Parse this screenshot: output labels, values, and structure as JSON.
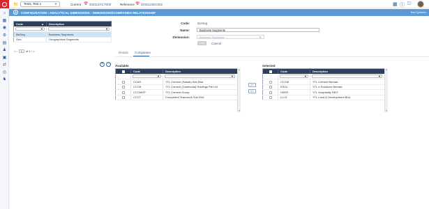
{
  "topbar": {
    "selector": "Test1, Test 1",
    "current_label": "Current",
    "current_value": "202112ACT000",
    "reference_label": "Reference",
    "reference_value": "201512JEC002"
  },
  "breadcrumb": {
    "text": "CONFIGURATION › ANALYTICAL DIMENSIONS › DIMENSIONS/COMPANIES RELATIONSHIP",
    "right_text": "Test Cyadmin"
  },
  "left_grid": {
    "headers": [
      "Code",
      "Description"
    ],
    "rows": [
      {
        "code": "BizSeg",
        "description": "Business Segments"
      },
      {
        "code": "Geo",
        "description": "Geographical Segments"
      }
    ]
  },
  "pager": {
    "page": "1",
    "of_text": "of 1"
  },
  "form": {
    "code_label": "Code:",
    "code_value": "BizSeg",
    "name_label": "Name:",
    "name_value": "Business Segments",
    "dimension_label": "Dimension:",
    "dimension_value": "Business Segments",
    "save_label": "Save",
    "cancel_label": "Cancel"
  },
  "tabs": [
    {
      "label": "Details"
    },
    {
      "label": "Companies"
    }
  ],
  "available": {
    "title": "Available",
    "headers": [
      "Code",
      "Description"
    ],
    "rows": [
      {
        "code": "CCAS",
        "description": "YTL Cement (Sabah) Sdn Bhd"
      },
      {
        "code": "CCCB",
        "description": "YTL Cement (Cambodia) Holdings Pte Ltd"
      },
      {
        "code": "CCCMGP",
        "description": "YTL Cement Group"
      },
      {
        "code": "CCCT",
        "description": "Competent Teamwork Sdn Bhd"
      }
    ]
  },
  "move_buttons": {
    "right": ">>",
    "left": "<<"
  },
  "selected": {
    "title": "Selected",
    "headers": [
      "Code",
      "Description"
    ],
    "rows": [
      {
        "code": "CCCM",
        "description": "YTL Cement Berhad"
      },
      {
        "code": "ESOL",
        "description": "YTL e-Solutions Berhad"
      },
      {
        "code": "HSER",
        "description": "YTL Hospitality REIT"
      },
      {
        "code": "LLLD",
        "description": "YTL Land & Development Bhd"
      }
    ]
  },
  "colors": {
    "brand": "#d9262f",
    "accent": "#2f5f9a",
    "breadcrumb_bg": "#5b9bd5",
    "grid_header": "#2d3f5c",
    "selected_row": "#cfe3f7"
  }
}
